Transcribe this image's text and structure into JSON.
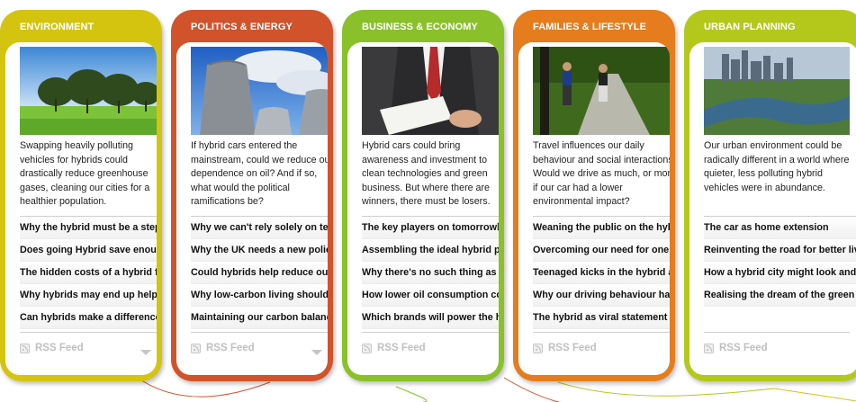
{
  "cards": [
    {
      "title": "ENVIRONMENT",
      "color": "#d4c40f",
      "image_subject": "trees-on-grass-photo",
      "description": "Swapping heavily polluting vehicles for hybrids could drastically reduce greenhouse gases, cleaning our cities for a healthier population.",
      "links": [
        "Why the hybrid must be a stepping stone",
        "Does going Hybrid save enough",
        "The hidden costs of a hybrid fleet",
        "Why hybrids may end up helping",
        "Can hybrids make a difference in"
      ],
      "rss_label": "RSS Feed"
    },
    {
      "title": "POLITICS & ENERGY",
      "color": "#d1532c",
      "image_subject": "cooling-towers-photo",
      "description": "If hybrid cars entered the mainstream, could we reduce our dependence on oil? And if so, what would the political ramifications be?",
      "links": [
        "Why we can't rely solely on technology",
        "Why the UK needs a new policy",
        "Could hybrids help reduce our trade",
        "Why low-carbon living should be",
        "Maintaining our carbon balance"
      ],
      "rss_label": "RSS Feed"
    },
    {
      "title": "BUSINESS & ECONOMY",
      "color": "#8ac12a",
      "image_subject": "businessman-with-papers-photo",
      "description": "Hybrid cars could bring awareness and investment to clean technologies and green business. But where there are winners, there must be losers.",
      "links": [
        "The key players on tomorrow☐",
        "Assembling the ideal hybrid package",
        "Why there's no such thing as a free",
        "How lower oil consumption could",
        "Which brands will power the hybrid"
      ],
      "rss_label": "RSS Feed"
    },
    {
      "title": "FAMILIES & LIFESTYLE",
      "color": "#e57c1d",
      "image_subject": "joggers-on-path-photo",
      "description": "Travel influences our daily behaviour and social interactions. Would we drive as much, or more, if our car had a lower environmental impact?",
      "links": [
        "Weaning the public on the hybrid",
        "Overcoming our need for one car",
        "Teenaged kicks in the hybrid age",
        "Why our driving behaviour has to",
        "The hybrid as viral statement"
      ],
      "rss_label": "RSS Feed"
    },
    {
      "title": "URBAN PLANNING",
      "color": "#b3c81b",
      "image_subject": "city-skyline-river-photo",
      "description": "Our urban environment could be radically different in a world where quieter, less polluting hybrid vehicles were in abundance.",
      "links": [
        "The car as home extension",
        "Reinventing the road for better living",
        "How a hybrid city might look and",
        "Realising the dream of the green"
      ],
      "rss_label": "RSS Feed"
    }
  ]
}
